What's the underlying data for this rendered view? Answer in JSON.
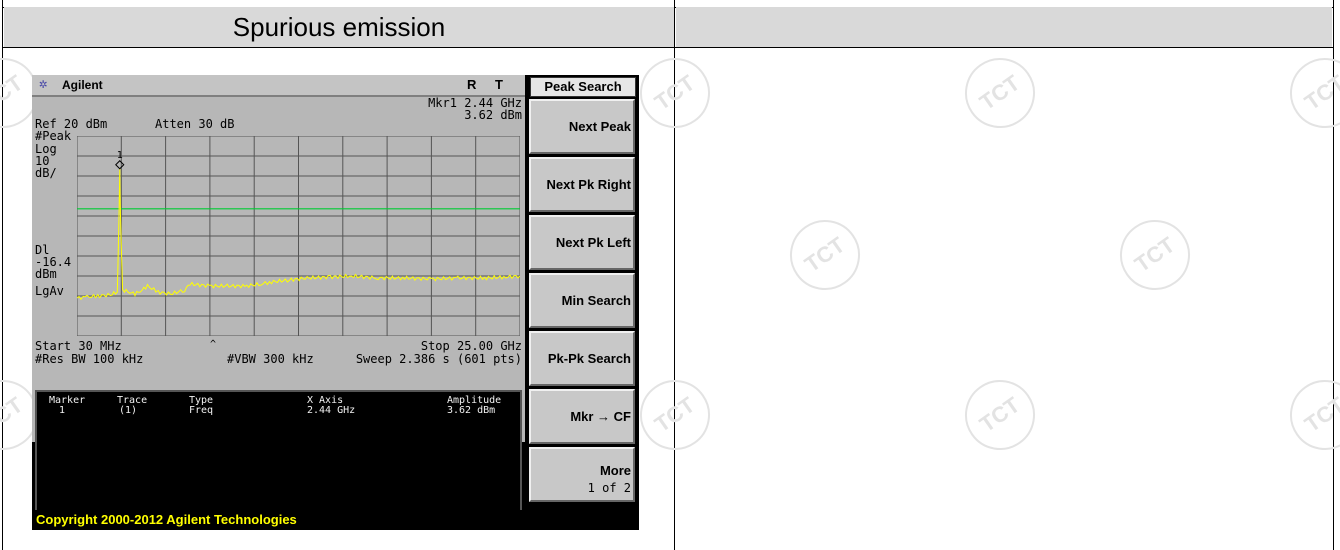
{
  "report": {
    "header_left": "Spurious emission",
    "header_right": "",
    "watermark": "TCT"
  },
  "analyzer": {
    "brand": "Agilent",
    "status_r": "R",
    "status_t": "T",
    "marker_readout": "Mkr1  2.44 GHz",
    "marker_amplitude": "3.62 dBm",
    "ref_level": "Ref 20 dBm",
    "attenuation": "Atten 30 dB",
    "detector": "#Peak",
    "scale_log": "Log",
    "scale_value": "10",
    "scale_unit": "dB/",
    "marker_number": "1",
    "display_line_label": "Dl",
    "display_line_value": "-16.4",
    "display_line_unit": "dBm",
    "average_type": "LgAv",
    "start_freq": "Start 30 MHz",
    "stop_freq": "Stop 25.00 GHz",
    "res_bw": "#Res BW 100 kHz",
    "vbw": "#VBW 300 kHz",
    "sweep": "Sweep 2.386 s (601 pts)",
    "marker_table": {
      "headers": [
        "Marker",
        "Trace",
        "Type",
        "X Axis",
        "Amplitude"
      ],
      "rows": [
        [
          "1",
          "(1)",
          "Freq",
          "2.44 GHz",
          "3.62 dBm"
        ]
      ]
    },
    "copyright": "Copyright 2000-2012 Agilent Technologies"
  },
  "softkeys": {
    "title": "Peak Search",
    "keys": [
      {
        "label": "Next Peak"
      },
      {
        "label": "Next Pk Right"
      },
      {
        "label": "Next Pk Left"
      },
      {
        "label": "Min Search"
      },
      {
        "label": "Pk-Pk Search"
      },
      {
        "label": "Mkr → CF"
      },
      {
        "label": "More",
        "sub": "1 of 2"
      }
    ]
  },
  "colors": {
    "trace": "#ffff00",
    "display_line": "#00cc33",
    "graticule": "#555555",
    "screen_bg": "#000000",
    "softkey_bg": "#c8c8c8"
  },
  "chart_data": {
    "type": "line",
    "title": "",
    "xlabel": "",
    "ylabel": "",
    "xlim_ghz": [
      0.03,
      25.0
    ],
    "ylim_dbm": [
      -80,
      20
    ],
    "display_line_dbm": -16.4,
    "grid": true,
    "series": [
      {
        "points": [
          [
            0.03,
            -61
          ],
          [
            0.6,
            -60.5
          ],
          [
            1.2,
            -60
          ],
          [
            1.9,
            -59.5
          ],
          [
            2.3,
            -58
          ],
          [
            2.4,
            -20
          ],
          [
            2.44,
            3.62
          ],
          [
            2.48,
            -20
          ],
          [
            2.6,
            -57
          ],
          [
            3.0,
            -58
          ],
          [
            3.3,
            -59
          ],
          [
            3.7,
            -57
          ],
          [
            4.0,
            -55
          ],
          [
            4.6,
            -58
          ],
          [
            5.3,
            -59
          ],
          [
            6.1,
            -57
          ],
          [
            6.4,
            -54
          ],
          [
            7.5,
            -55
          ],
          [
            8.5,
            -55
          ],
          [
            9.6,
            -55
          ],
          [
            10.4,
            -54
          ],
          [
            11.0,
            -53
          ],
          [
            12.0,
            -52
          ],
          [
            13.0,
            -51
          ],
          [
            14.3,
            -50.5
          ],
          [
            15.5,
            -50
          ],
          [
            17.0,
            -51
          ],
          [
            18.5,
            -51
          ],
          [
            20.0,
            -51.5
          ],
          [
            21.5,
            -51
          ],
          [
            23.0,
            -51
          ],
          [
            24.2,
            -50.5
          ],
          [
            25.0,
            -50
          ]
        ]
      }
    ]
  }
}
